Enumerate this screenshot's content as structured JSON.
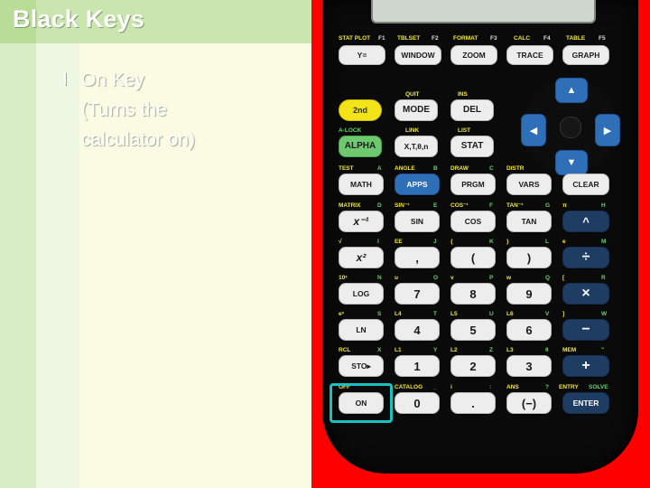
{
  "slide": {
    "title": "Black Keys",
    "bullet_marker": "l",
    "bullet_text": "On Key (Turns the calculator on)",
    "bullet_line1": "On Key",
    "bullet_line2": "(Turns the",
    "bullet_line3": "calculator on)",
    "title_band_color": "#cbe5ae",
    "body_color": "#fbfbe3",
    "text_color": "#ffffff"
  },
  "calculator": {
    "background_color": "#fe0000",
    "body_color": "#0a0a0a",
    "screen_color": "#cfd6cd",
    "highlight_color": "#18c2c2",
    "highlighted_key": "ON",
    "rows": {
      "fkeys": [
        {
          "label": "Y=",
          "above": "STAT PLOT",
          "above_right": "F1"
        },
        {
          "label": "WINDOW",
          "above": "TBLSET",
          "above_right": "F2"
        },
        {
          "label": "ZOOM",
          "above": "FORMAT",
          "above_right": "F3"
        },
        {
          "label": "TRACE",
          "above": "CALC",
          "above_right": "F4"
        },
        {
          "label": "GRAPH",
          "above": "TABLE",
          "above_right": "F5"
        }
      ],
      "row2": [
        {
          "label": "2nd",
          "above": ""
        },
        {
          "label": "MODE",
          "above": "QUIT"
        },
        {
          "label": "DEL",
          "above": "INS"
        }
      ],
      "row3": [
        {
          "label": "ALPHA",
          "above": "A-LOCK"
        },
        {
          "label": "X,T,θ,n",
          "above": "LINK"
        },
        {
          "label": "STAT",
          "above": "LIST"
        }
      ],
      "row4": [
        {
          "label": "MATH",
          "above": "TEST",
          "alpha": "A"
        },
        {
          "label": "APPS",
          "above": "ANGLE",
          "alpha": "B"
        },
        {
          "label": "PRGM",
          "above": "DRAW",
          "alpha": "C"
        },
        {
          "label": "VARS",
          "above": "DISTR",
          "alpha": ""
        },
        {
          "label": "CLEAR",
          "above": "",
          "alpha": ""
        }
      ],
      "row5": [
        {
          "label": "x⁻¹",
          "above": "MATRIX",
          "alpha": "D"
        },
        {
          "label": "SIN",
          "above": "SIN⁻¹",
          "alpha": "E"
        },
        {
          "label": "COS",
          "above": "COS⁻¹",
          "alpha": "F"
        },
        {
          "label": "TAN",
          "above": "TAN⁻¹",
          "alpha": "G"
        },
        {
          "label": "^",
          "above": "π",
          "alpha": "H"
        }
      ],
      "row6": [
        {
          "label": "x²",
          "above": "√",
          "alpha": "I"
        },
        {
          "label": ",",
          "above": "EE",
          "alpha": "J"
        },
        {
          "label": "(",
          "above": "{",
          "alpha": "K"
        },
        {
          "label": ")",
          "above": "}",
          "alpha": "L"
        },
        {
          "label": "÷",
          "above": "e",
          "alpha": "M"
        }
      ],
      "row7": [
        {
          "label": "LOG",
          "above": "10ˣ",
          "alpha": "N"
        },
        {
          "label": "7",
          "above": "u",
          "alpha": "O"
        },
        {
          "label": "8",
          "above": "v",
          "alpha": "P"
        },
        {
          "label": "9",
          "above": "w",
          "alpha": "Q"
        },
        {
          "label": "×",
          "above": "[",
          "alpha": "R"
        }
      ],
      "row8": [
        {
          "label": "LN",
          "above": "eˣ",
          "alpha": "S"
        },
        {
          "label": "4",
          "above": "L4",
          "alpha": "T"
        },
        {
          "label": "5",
          "above": "L5",
          "alpha": "U"
        },
        {
          "label": "6",
          "above": "L6",
          "alpha": "V"
        },
        {
          "label": "−",
          "above": "]",
          "alpha": "W"
        }
      ],
      "row9": [
        {
          "label": "STO▸",
          "above": "RCL",
          "alpha": "X"
        },
        {
          "label": "1",
          "above": "L1",
          "alpha": "Y"
        },
        {
          "label": "2",
          "above": "L2",
          "alpha": "Z"
        },
        {
          "label": "3",
          "above": "L3",
          "alpha": "θ"
        },
        {
          "label": "+",
          "above": "MEM",
          "alpha": "\""
        }
      ],
      "row10": [
        {
          "label": "ON",
          "above": "OFF",
          "alpha": ""
        },
        {
          "label": "0",
          "above": "CATALOG",
          "alpha": "_"
        },
        {
          "label": ".",
          "above": "i",
          "alpha": ":"
        },
        {
          "label": "(−)",
          "above": "ANS",
          "alpha": "?"
        },
        {
          "label": "ENTER",
          "above": "ENTRY",
          "alpha": "SOLVE"
        }
      ]
    },
    "dpad": {
      "up": "▲",
      "down": "▼",
      "left": "◀",
      "right": "▶"
    }
  }
}
